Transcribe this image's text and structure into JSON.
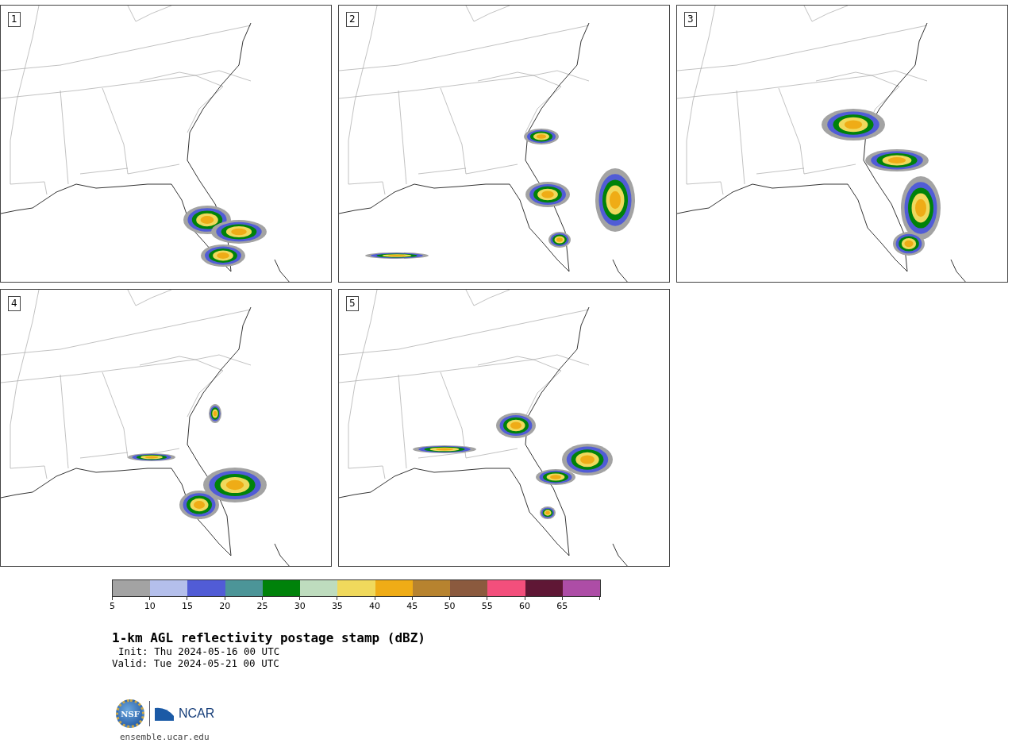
{
  "panels": [
    {
      "label": "1"
    },
    {
      "label": "2"
    },
    {
      "label": "3"
    },
    {
      "label": "4"
    },
    {
      "label": "5"
    }
  ],
  "colorbar": {
    "bins": [
      {
        "color": "#a3a3a3"
      },
      {
        "color": "#b4bfeb"
      },
      {
        "color": "#515cd6"
      },
      {
        "color": "#4c9598"
      },
      {
        "color": "#00820a"
      },
      {
        "color": "#bedcbe"
      },
      {
        "color": "#f0d95c"
      },
      {
        "color": "#efac16"
      },
      {
        "color": "#b7832f"
      },
      {
        "color": "#8b5a3e"
      },
      {
        "color": "#f34f7c"
      },
      {
        "color": "#5f1735"
      },
      {
        "color": "#ad4da6"
      }
    ],
    "ticks": [
      "5",
      "10",
      "15",
      "20",
      "25",
      "30",
      "35",
      "40",
      "45",
      "50",
      "55",
      "60",
      "65"
    ]
  },
  "title": "1-km AGL reflectivity postage stamp (dBZ)",
  "init": "Init: Thu 2024-05-16 00 UTC",
  "valid": "Valid: Tue 2024-05-21 00 UTC",
  "logo": {
    "left": "NSF",
    "right": "NCAR"
  },
  "site": "ensemble.ucar.edu"
}
